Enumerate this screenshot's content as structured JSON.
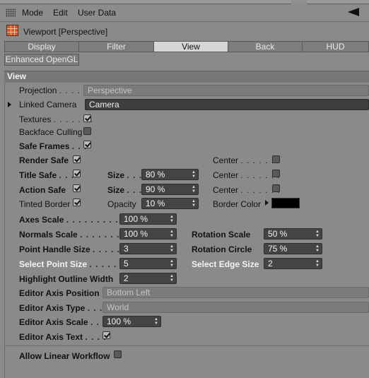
{
  "menu": {
    "mode": "Mode",
    "edit": "Edit",
    "user_data": "User Data"
  },
  "title": "Viewport [Perspective]",
  "tabs": [
    "Display",
    "Filter",
    "View",
    "Back",
    "HUD"
  ],
  "tab_extra": "Enhanced OpenGL",
  "section": "View",
  "projection": {
    "label": "Projection",
    "dots": ". . . . .",
    "value": "Perspective"
  },
  "linked_camera": {
    "label": "Linked Camera",
    "value": "Camera"
  },
  "textures": {
    "label": "Textures",
    "dots": ". . . . . . .",
    "checked": true
  },
  "backface": {
    "label": "Backface Culling",
    "checked": false
  },
  "safe_frames": {
    "label": "Safe Frames",
    "dots": ". . .",
    "checked": true
  },
  "render_safe": {
    "label": "Render Safe",
    "checked": true,
    "center_label": "Center",
    "center_dots": ". . . . . . .",
    "center_checked": false
  },
  "title_safe": {
    "label": "Title Safe",
    "dots": ". . .",
    "checked": true,
    "size_label": "Size",
    "size_dots": ". . .",
    "size_value": "80 %",
    "center_label": "Center",
    "center_dots": ". . . . . . .",
    "center_checked": false
  },
  "action_safe": {
    "label": "Action Safe",
    "checked": true,
    "size_label": "Size",
    "size_dots": ". . .",
    "size_value": "90 %",
    "center_label": "Center",
    "center_dots": ". . . . . . .",
    "center_checked": false
  },
  "tinted_border": {
    "label": "Tinted Border",
    "checked": true,
    "opacity_label": "Opacity",
    "opacity_value": "10 %",
    "border_color_label": "Border Color",
    "border_color": "#000000"
  },
  "axes_scale": {
    "label": "Axes Scale",
    "dots": ". . . . . . . . . . . .",
    "value": "100 %"
  },
  "normals_scale": {
    "label": "Normals Scale",
    "dots": ". . . . . . . .",
    "value": "100 %",
    "rot_label": "Rotation Scale",
    "rot_value": "50 %"
  },
  "point_handle": {
    "label": "Point Handle Size",
    "dots": ". . . . .",
    "value": "3",
    "rot_label": "Rotation Circle",
    "rot_value": "75 %"
  },
  "select_point": {
    "label": "Select Point Size",
    "dots": ". . . . .",
    "value": "5",
    "edge_label": "Select Edge Size",
    "edge_value": "2"
  },
  "highlight": {
    "label": "Highlight Outline Width",
    "value": "2"
  },
  "axis_position": {
    "label": "Editor Axis Position",
    "value": "Bottom Left"
  },
  "axis_type": {
    "label": "Editor Axis Type",
    "dots": ". . .",
    "value": "World"
  },
  "axis_scale": {
    "label": "Editor Axis Scale",
    "dots": ". . .",
    "value": "100 %"
  },
  "axis_text": {
    "label": "Editor Axis Text",
    "dots": ". . . .",
    "checked": true
  },
  "linear_workflow": {
    "label": "Allow Linear Workflow",
    "checked": false
  }
}
